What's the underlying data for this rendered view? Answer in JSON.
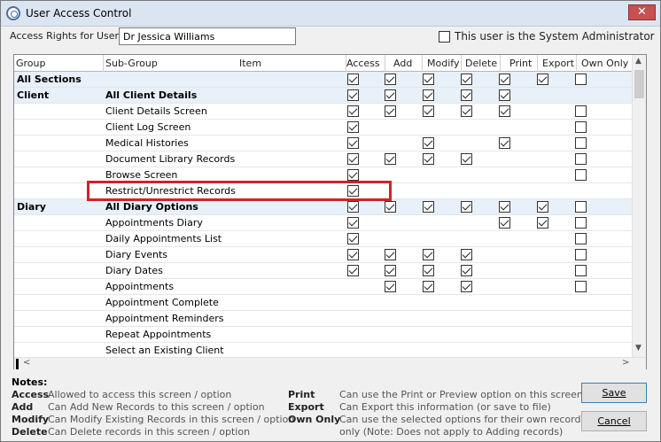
{
  "window": {
    "title": "User Access Control",
    "close_label": "✕"
  },
  "user": {
    "rights_label": "Access Rights for User:",
    "name": "Dr Jessica Williams"
  },
  "sysadmin": {
    "label": "This user is the System Administrator",
    "checked": false
  },
  "columns": {
    "group": "Group",
    "subgroup": "Sub-Group",
    "item": "Item",
    "access": "Access",
    "add": "Add",
    "modify": "Modify",
    "delete": "Delete",
    "print": "Print",
    "export": "Export",
    "own_only": "Own Only"
  },
  "rows": [
    {
      "group": "All Sections",
      "subgroup": "",
      "section": true,
      "bold_group": true,
      "bold_sub": false,
      "perms": {
        "access": true,
        "add": true,
        "modify": true,
        "delete": true,
        "print": true,
        "export": true,
        "own_only": false
      }
    },
    {
      "group": "Client",
      "subgroup": "All Client Details",
      "section": true,
      "bold_group": true,
      "bold_sub": true,
      "perms": {
        "access": true,
        "add": true,
        "modify": true,
        "delete": true,
        "print": true,
        "export": null,
        "own_only": null
      }
    },
    {
      "group": "",
      "subgroup": "Client Details Screen",
      "section": false,
      "perms": {
        "access": true,
        "add": true,
        "modify": true,
        "delete": true,
        "print": true,
        "export": null,
        "own_only": false
      }
    },
    {
      "group": "",
      "subgroup": "Client Log Screen",
      "section": false,
      "perms": {
        "access": true,
        "add": null,
        "modify": null,
        "delete": null,
        "print": null,
        "export": null,
        "own_only": false
      }
    },
    {
      "group": "",
      "subgroup": "Medical Histories",
      "section": false,
      "perms": {
        "access": true,
        "add": null,
        "modify": true,
        "delete": null,
        "print": true,
        "export": null,
        "own_only": false
      }
    },
    {
      "group": "",
      "subgroup": "Document Library Records",
      "section": false,
      "perms": {
        "access": true,
        "add": true,
        "modify": true,
        "delete": true,
        "print": null,
        "export": null,
        "own_only": false
      }
    },
    {
      "group": "",
      "subgroup": "Browse Screen",
      "section": false,
      "perms": {
        "access": true,
        "add": null,
        "modify": null,
        "delete": null,
        "print": null,
        "export": null,
        "own_only": false
      }
    },
    {
      "group": "",
      "subgroup": "Restrict/Unrestrict Records",
      "section": false,
      "perms": {
        "access": true,
        "add": null,
        "modify": null,
        "delete": null,
        "print": null,
        "export": null,
        "own_only": null
      }
    },
    {
      "group": "Diary",
      "subgroup": "All Diary Options",
      "section": true,
      "bold_group": true,
      "bold_sub": true,
      "perms": {
        "access": true,
        "add": true,
        "modify": true,
        "delete": true,
        "print": true,
        "export": true,
        "own_only": false
      }
    },
    {
      "group": "",
      "subgroup": "Appointments Diary",
      "section": false,
      "perms": {
        "access": true,
        "add": null,
        "modify": null,
        "delete": null,
        "print": true,
        "export": true,
        "own_only": false
      }
    },
    {
      "group": "",
      "subgroup": "Daily Appointments List",
      "section": false,
      "perms": {
        "access": true,
        "add": null,
        "modify": null,
        "delete": null,
        "print": null,
        "export": null,
        "own_only": false
      }
    },
    {
      "group": "",
      "subgroup": "Diary Events",
      "section": false,
      "perms": {
        "access": true,
        "add": true,
        "modify": true,
        "delete": true,
        "print": null,
        "export": null,
        "own_only": false
      }
    },
    {
      "group": "",
      "subgroup": "Diary Dates",
      "section": false,
      "perms": {
        "access": true,
        "add": true,
        "modify": true,
        "delete": true,
        "print": null,
        "export": null,
        "own_only": false
      }
    },
    {
      "group": "",
      "subgroup": "Appointments",
      "section": false,
      "perms": {
        "access": null,
        "add": true,
        "modify": true,
        "delete": true,
        "print": null,
        "export": null,
        "own_only": false
      }
    },
    {
      "group": "",
      "subgroup": "Appointment Complete",
      "section": false,
      "perms": {
        "access": null,
        "add": null,
        "modify": null,
        "delete": null,
        "print": null,
        "export": null,
        "own_only": null
      }
    },
    {
      "group": "",
      "subgroup": "Appointment Reminders",
      "section": false,
      "perms": {
        "access": null,
        "add": null,
        "modify": null,
        "delete": null,
        "print": null,
        "export": null,
        "own_only": null
      }
    },
    {
      "group": "",
      "subgroup": "Repeat Appointments",
      "section": false,
      "perms": {
        "access": null,
        "add": null,
        "modify": null,
        "delete": null,
        "print": null,
        "export": null,
        "own_only": null
      }
    },
    {
      "group": "",
      "subgroup": "Select an Existing Client",
      "section": false,
      "perms": {
        "access": null,
        "add": null,
        "modify": null,
        "delete": null,
        "print": null,
        "export": null,
        "own_only": null
      }
    }
  ],
  "scroll": {
    "up": "▲",
    "down": "▼",
    "left": "<",
    "right": ">"
  },
  "notes": {
    "title": "Notes:",
    "left": [
      {
        "key": "Access",
        "text": "Allowed to access this screen / option"
      },
      {
        "key": "Add",
        "text": "Can Add New Records to this screen / option"
      },
      {
        "key": "Modify",
        "text": "Can Modify Existing Records in this screen / option"
      },
      {
        "key": "Delete",
        "text": "Can Delete records in this screen / option"
      }
    ],
    "right": [
      {
        "key": "Print",
        "text": "Can use the Print or Preview option on this screen"
      },
      {
        "key": "Export",
        "text": "Can Export this information (or save to file)"
      },
      {
        "key": "Own Only",
        "text": "Can use the selected options for their own records"
      },
      {
        "key": "",
        "text": "only (Note: Does not apply to Adding records)"
      }
    ]
  },
  "buttons": {
    "save": "Save",
    "cancel": "Cancel"
  }
}
